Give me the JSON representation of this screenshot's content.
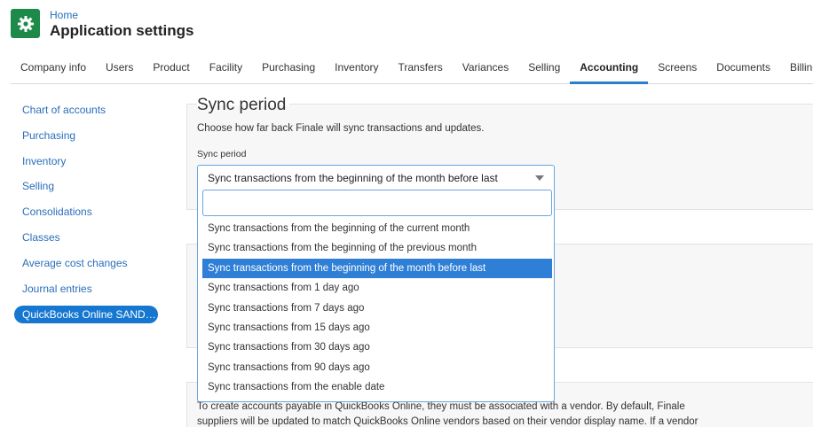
{
  "header": {
    "breadcrumb": "Home",
    "title": "Application settings",
    "logo_icon": "gear-icon",
    "logo_color": "#1e8a4a"
  },
  "tabs": [
    {
      "label": "Company info",
      "active": false
    },
    {
      "label": "Users",
      "active": false
    },
    {
      "label": "Product",
      "active": false
    },
    {
      "label": "Facility",
      "active": false
    },
    {
      "label": "Purchasing",
      "active": false
    },
    {
      "label": "Inventory",
      "active": false
    },
    {
      "label": "Transfers",
      "active": false
    },
    {
      "label": "Variances",
      "active": false
    },
    {
      "label": "Selling",
      "active": false
    },
    {
      "label": "Accounting",
      "active": true
    },
    {
      "label": "Screens",
      "active": false
    },
    {
      "label": "Documents",
      "active": false
    },
    {
      "label": "Billing",
      "active": false
    }
  ],
  "sidebar": {
    "items": [
      {
        "label": "Chart of accounts",
        "active": false
      },
      {
        "label": "Purchasing",
        "active": false
      },
      {
        "label": "Inventory",
        "active": false
      },
      {
        "label": "Selling",
        "active": false
      },
      {
        "label": "Consolidations",
        "active": false
      },
      {
        "label": "Classes",
        "active": false
      },
      {
        "label": "Average cost changes",
        "active": false
      },
      {
        "label": "Journal entries",
        "active": false
      },
      {
        "label": "QuickBooks Online SANDBOX",
        "active": true
      }
    ]
  },
  "sync_period": {
    "title": "Sync period",
    "description": "Choose how far back Finale will sync transactions and updates.",
    "field_label": "Sync period",
    "selected_value": "Sync transactions from the beginning of the month before last",
    "search_value": "",
    "options": [
      {
        "label": "Sync transactions from the beginning of the current month",
        "selected": false
      },
      {
        "label": "Sync transactions from the beginning of the previous month",
        "selected": false
      },
      {
        "label": "Sync transactions from the beginning of the month before last",
        "selected": true
      },
      {
        "label": "Sync transactions from 1 day ago",
        "selected": false
      },
      {
        "label": "Sync transactions from 7 days ago",
        "selected": false
      },
      {
        "label": "Sync transactions from 15 days ago",
        "selected": false
      },
      {
        "label": "Sync transactions from 30 days ago",
        "selected": false
      },
      {
        "label": "Sync transactions from 90 days ago",
        "selected": false
      },
      {
        "label": "Sync transactions from the enable date",
        "selected": false
      }
    ]
  },
  "vendors_section": {
    "line1": "To create accounts payable in QuickBooks Online, they must be associated with a vendor. By default, Finale",
    "line2": "suppliers will be updated to match QuickBooks Online vendors based on their vendor display name. If a vendor"
  },
  "colors": {
    "accent": "#1677d1",
    "selected_option": "#2f7fd6",
    "link": "#2a6ebb"
  }
}
